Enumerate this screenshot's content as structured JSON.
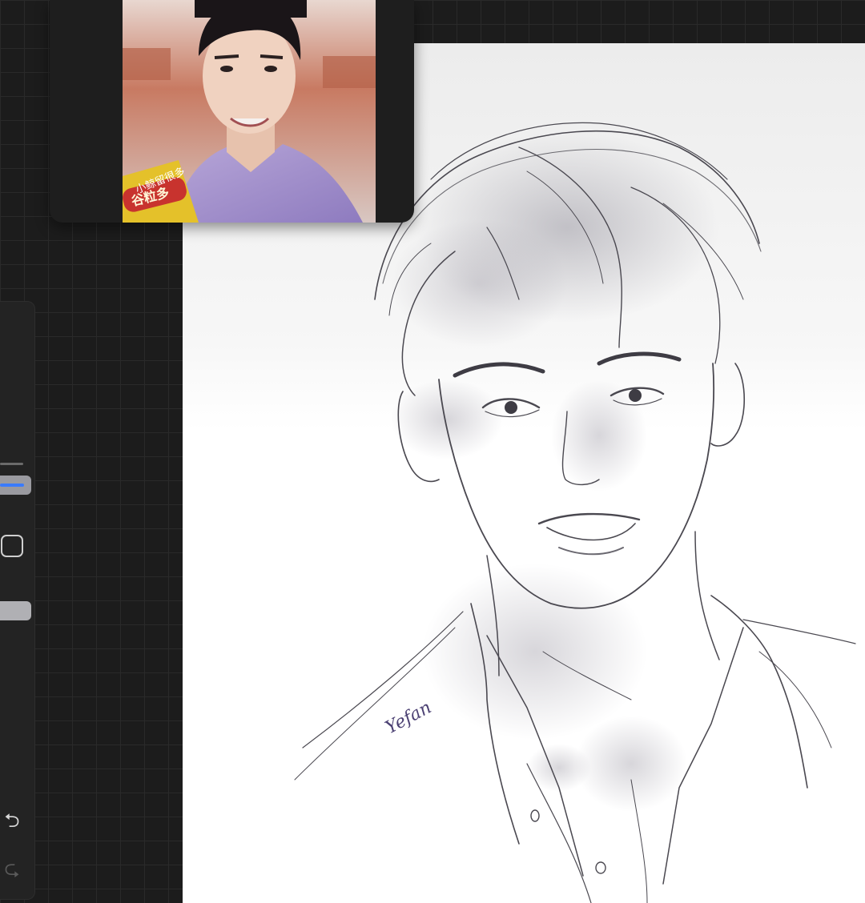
{
  "reference": {
    "caption_line1": "小鲸留很多",
    "caption_line2": "谷粒多"
  },
  "artwork": {
    "signature": "Yefan"
  },
  "sidebar": {
    "undo_icon": "undo-icon",
    "redo_icon": "redo-icon",
    "modify_icon": "square-modify-icon",
    "undo_glyph": "⮌",
    "redo_glyph": "⮎"
  },
  "colors": {
    "accent": "#3a7bff",
    "canvas": "#ffffff",
    "workspace": "#1c1c1c"
  }
}
